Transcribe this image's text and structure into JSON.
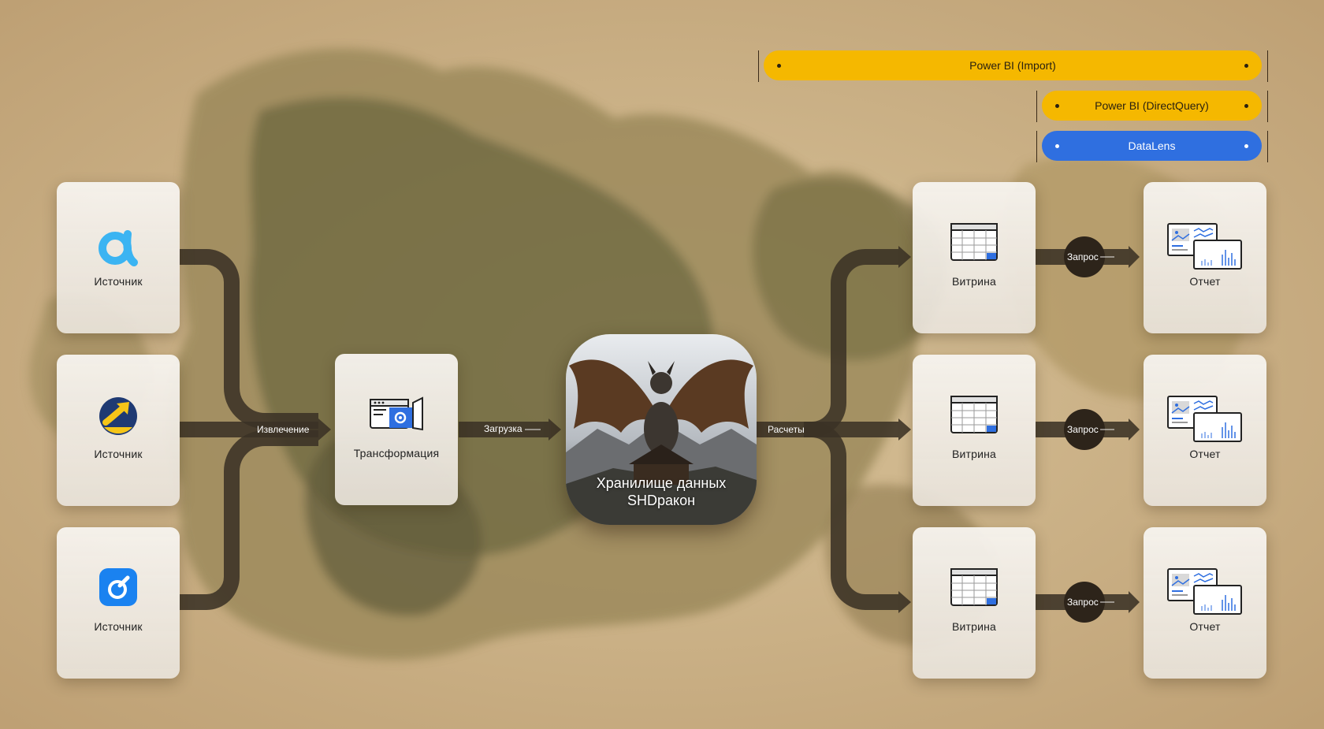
{
  "sources": [
    {
      "label": "Источник",
      "icon": "letter-a-icon"
    },
    {
      "label": "Источник",
      "icon": "yellow-arrow-circle-icon"
    },
    {
      "label": "Источник",
      "icon": "blue-app-icon"
    }
  ],
  "transform": {
    "label": "Трансформация",
    "icon": "gear-window-icon"
  },
  "storage": {
    "line1": "Хранилище данных",
    "line2": "SHDракон",
    "icon": "dragon-image"
  },
  "edges": {
    "extract": "Извлечение",
    "load": "Загрузка",
    "calc": "Расчеты",
    "query": "Запрос"
  },
  "marts": [
    {
      "label": "Витрина",
      "icon": "table-icon"
    },
    {
      "label": "Витрина",
      "icon": "table-icon"
    },
    {
      "label": "Витрина",
      "icon": "table-icon"
    }
  ],
  "reports": [
    {
      "label": "Отчет",
      "icon": "report-dashboard-icon"
    },
    {
      "label": "Отчет",
      "icon": "report-dashboard-icon"
    },
    {
      "label": "Отчет",
      "icon": "report-dashboard-icon"
    }
  ],
  "tools": [
    {
      "label": "Power BI (Import)",
      "color": "#f5b800"
    },
    {
      "label": "Power BI (DirectQuery)",
      "color": "#f5b800"
    },
    {
      "label": "DataLens",
      "color": "#2f6fe0"
    }
  ],
  "colors": {
    "pipe": "#3b3226",
    "accent_blue": "#2f6fe0",
    "accent_yellow": "#f5b800"
  }
}
